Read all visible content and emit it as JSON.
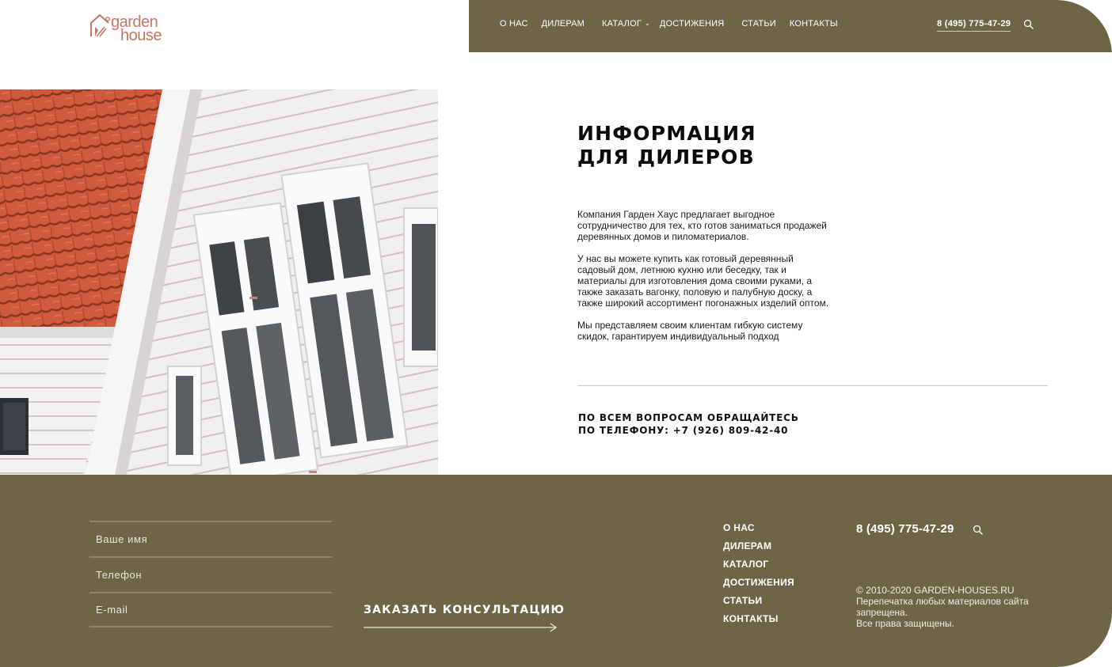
{
  "brand": {
    "logo_word1": "garden",
    "logo_word2": "house",
    "color": "#c07a66"
  },
  "header": {
    "nav": [
      {
        "label": "О НАС"
      },
      {
        "label": "ДИЛЕРАМ"
      },
      {
        "label": "КАТАЛОГ",
        "has_dropdown": true
      },
      {
        "label": "ДОСТИЖЕНИЯ"
      },
      {
        "label": "СТАТЬИ"
      },
      {
        "label": "КОНТАКТЫ"
      }
    ],
    "phone": "8 (495) 775-47-29",
    "search_icon": "search-icon",
    "bg_color": "#6e6547"
  },
  "main": {
    "title_line1": "ИНФОРМАЦИЯ",
    "title_line2": "ДЛЯ ДИЛЕРОВ",
    "paragraphs": [
      "Компания Гарден Хаус предлагает выгодное сотрудничество для тех, кто готов заниматься продажей деревянных домов и пиломатериалов.",
      "У нас вы можете купить как готовый деревянный садовый дом, летнюю кухню или беседку, так и материалы для изготовления дома своими руками, а также заказать вагонку, половую и палубную доску, а также широкий ассортимент погонажных изделий оптом.",
      "Мы представляем своим клиентам гибкую систему скидок, гарантируем индивидуальный подход"
    ],
    "contact_line1": "ПО ВСЕМ ВОПРОСАМ ОБРАЩАЙТЕСЬ",
    "contact_line2": "ПО ТЕЛЕФОНУ: +7 (926) 809-42-40"
  },
  "footer": {
    "form": {
      "name_placeholder": "Ваше имя",
      "phone_placeholder": "Телефон",
      "email_placeholder": "E-mail"
    },
    "order_button": "ЗАКАЗАТЬ КОНСУЛЬТАЦИЮ",
    "nav": [
      {
        "label": "О НАС"
      },
      {
        "label": "ДИЛЕРАМ"
      },
      {
        "label": "КАТАЛОГ"
      },
      {
        "label": "ДОСТИЖЕНИЯ"
      },
      {
        "label": "СТАТЬИ"
      },
      {
        "label": "КОНТАКТЫ"
      }
    ],
    "phone": "8 (495) 775-47-29",
    "copyright_line1": "© 2010-2020 GARDEN-HOUSES.RU",
    "copyright_line2": "Перепечатка любых материалов сайта",
    "copyright_line3": "запрещена.",
    "copyright_line4": "Все права защищены.",
    "bg_color": "#6e6547"
  }
}
